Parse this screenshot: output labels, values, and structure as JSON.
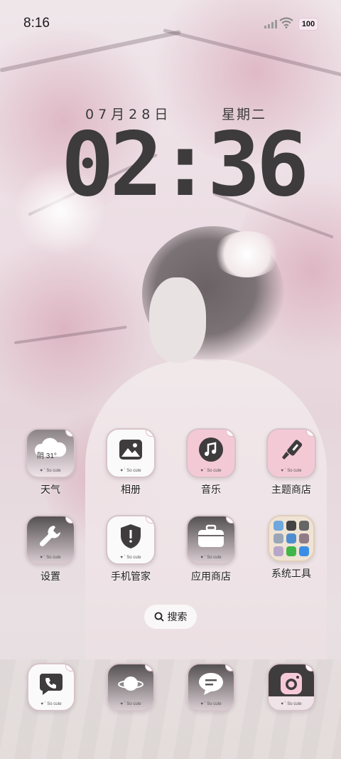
{
  "status_bar": {
    "time": "8:16",
    "battery": "100"
  },
  "clock_widget": {
    "date": "07月28日",
    "weekday": "星期二",
    "time": "02:36"
  },
  "icon_caption": "♥ ˋ So cute",
  "apps_row1": [
    {
      "label": "天气",
      "icon": "weather-cloud-icon",
      "weather_text": "阴 31°"
    },
    {
      "label": "相册",
      "icon": "gallery-icon"
    },
    {
      "label": "音乐",
      "icon": "music-icon"
    },
    {
      "label": "主题商店",
      "icon": "theme-brush-icon"
    }
  ],
  "apps_row2": [
    {
      "label": "设置",
      "icon": "wrench-icon"
    },
    {
      "label": "手机管家",
      "icon": "shield-icon"
    },
    {
      "label": "应用商店",
      "icon": "briefcase-icon"
    },
    {
      "label": "系统工具",
      "icon": "folder-icon"
    }
  ],
  "search": {
    "label": "搜索"
  },
  "dock": [
    {
      "icon": "phone-icon"
    },
    {
      "icon": "browser-planet-icon"
    },
    {
      "icon": "message-icon"
    },
    {
      "icon": "camera-icon"
    }
  ],
  "colors": {
    "accent_pink": "#f4c9d6",
    "icon_dark": "#3d3b3c"
  }
}
